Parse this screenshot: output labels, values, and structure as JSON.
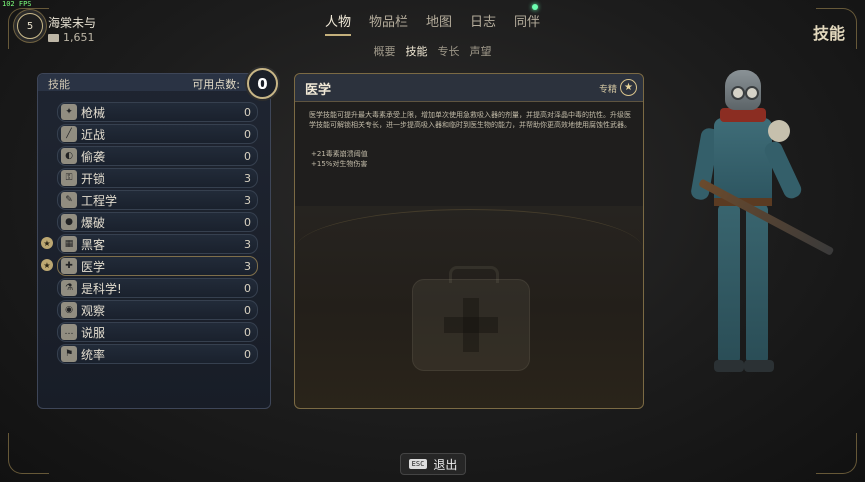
{
  "fps": "102 FPS",
  "player": {
    "level": "5",
    "name": "海棠未与",
    "money": "1,651"
  },
  "nav": {
    "tabs": [
      {
        "label": "人物"
      },
      {
        "label": "物品栏"
      },
      {
        "label": "地图"
      },
      {
        "label": "日志"
      },
      {
        "label": "同伴"
      }
    ],
    "subtabs": [
      {
        "label": "概要"
      },
      {
        "label": "技能"
      },
      {
        "label": "专长"
      },
      {
        "label": "声望"
      }
    ]
  },
  "page_title": "技能",
  "skills_panel": {
    "title": "技能",
    "points_label": "可用点数:",
    "points_value": "0",
    "skills": [
      {
        "name": "枪械",
        "value": "0",
        "icon": "gun-icon"
      },
      {
        "name": "近战",
        "value": "0",
        "icon": "melee-icon"
      },
      {
        "name": "偷袭",
        "value": "0",
        "icon": "sneak-icon"
      },
      {
        "name": "开锁",
        "value": "3",
        "icon": "lockpick-icon"
      },
      {
        "name": "工程学",
        "value": "3",
        "icon": "wrench-icon"
      },
      {
        "name": "爆破",
        "value": "0",
        "icon": "explosive-icon"
      },
      {
        "name": "黑客",
        "value": "3",
        "icon": "hack-icon"
      },
      {
        "name": "医学",
        "value": "3",
        "icon": "medkit-icon"
      },
      {
        "name": "是科学!",
        "value": "0",
        "icon": "science-icon"
      },
      {
        "name": "观察",
        "value": "0",
        "icon": "eye-icon"
      },
      {
        "name": "说服",
        "value": "0",
        "icon": "speech-icon"
      },
      {
        "name": "统率",
        "value": "0",
        "icon": "lead-icon"
      }
    ]
  },
  "detail": {
    "title": "医学",
    "spec_label": "专精",
    "description": "医学技能可提升最大毒素承受上限，增加单次使用急救吸入器的剂量，并提高对泽晶中毒的抗性。升级医学技能可解锁相关专长，进一步提高吸入器和临时到医生物的能力，并帮助你更高效地使用腐蚀性武器。",
    "bonuses": [
      "+21毒素崩溃阈值",
      "+15%对生物伤害"
    ]
  },
  "footer": {
    "esc_key": "ESC",
    "exit_label": "退出"
  }
}
